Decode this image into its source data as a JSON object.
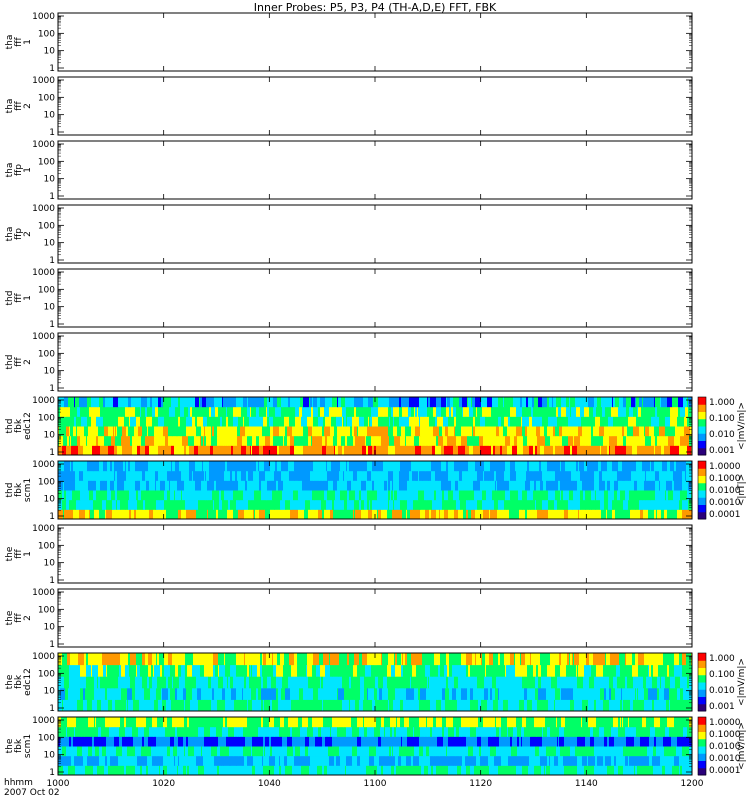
{
  "title": "Inner Probes: P5, P3, P4 (TH-A,D,E) FFT, FBK",
  "x_axis": {
    "ticks": [
      "1000",
      "1020",
      "1040",
      "1100",
      "1120",
      "1140",
      "1200"
    ],
    "label_line1": "hhmm",
    "label_line2": "2007 Oct 02"
  },
  "y_ticks": [
    "1000",
    "100",
    "10",
    "1"
  ],
  "panels": [
    {
      "id": "tha-fff-1",
      "label": [
        "tha",
        "fff",
        "1"
      ],
      "type": "empty"
    },
    {
      "id": "tha-fff-2",
      "label": [
        "tha",
        "fff",
        "2"
      ],
      "type": "empty"
    },
    {
      "id": "tha-ffp-1",
      "label": [
        "tha",
        "ffp",
        "1"
      ],
      "type": "empty"
    },
    {
      "id": "tha-ffp-2",
      "label": [
        "tha",
        "ffp",
        "2"
      ],
      "type": "empty"
    },
    {
      "id": "thd-fff-1",
      "label": [
        "thd",
        "fff",
        "1"
      ],
      "type": "empty"
    },
    {
      "id": "thd-fff-2",
      "label": [
        "thd",
        "fff",
        "2"
      ],
      "type": "empty"
    },
    {
      "id": "thd-fbk-edc12",
      "label": [
        "thd",
        "fbk",
        "edc12"
      ],
      "type": "spectrogram",
      "colorbar": {
        "ticks": [
          "1.000",
          "0.100",
          "0.010",
          "0.001"
        ],
        "unit": "<|mV/m|>"
      }
    },
    {
      "id": "thd-fbk-scm1",
      "label": [
        "thd",
        "fbk",
        "scm1"
      ],
      "type": "spectrogram",
      "colorbar": {
        "ticks": [
          "1.0000",
          "0.1000",
          "0.0100",
          "0.0010",
          "0.0001"
        ],
        "unit": "<|nT|>"
      }
    },
    {
      "id": "the-fff-1",
      "label": [
        "the",
        "fff",
        "1"
      ],
      "type": "empty"
    },
    {
      "id": "the-fff-2",
      "label": [
        "the",
        "fff",
        "2"
      ],
      "type": "empty"
    },
    {
      "id": "the-fbk-edc12",
      "label": [
        "the",
        "fbk",
        "edc12"
      ],
      "type": "spectrogram",
      "colorbar": {
        "ticks": [
          "1.000",
          "0.100",
          "0.010",
          "0.001"
        ],
        "unit": "<|mV/m|>"
      }
    },
    {
      "id": "the-fbk-scm1",
      "label": [
        "the",
        "fbk",
        "scm1"
      ],
      "type": "spectrogram",
      "colorbar": {
        "ticks": [
          "1.0000",
          "0.1000",
          "0.0100",
          "0.0010",
          "0.0001"
        ],
        "unit": "<|mV/m|>"
      }
    }
  ],
  "chart_data": {
    "type": "heatmap",
    "title": "Inner Probes: P5, P3, P4 (TH-A,D,E) FFT, FBK",
    "x_axis_label": "hhmm",
    "date": "2007 Oct 02",
    "x_ticks": [
      "1000",
      "1020",
      "1040",
      "1100",
      "1120",
      "1140",
      "1200"
    ],
    "x_range": [
      "1000",
      "1200"
    ],
    "y_scale": "log",
    "y_range": [
      1,
      1000
    ],
    "y_ticks": [
      1,
      10,
      100,
      1000
    ],
    "colorscale": [
      "#2a007a",
      "#0000ff",
      "#0099ff",
      "#00e5ff",
      "#00ff66",
      "#ffff00",
      "#ff9900",
      "#ff0000"
    ],
    "empty_panels": [
      "tha fff 1",
      "tha fff 2",
      "tha ffp 1",
      "tha ffp 2",
      "thd fff 1",
      "thd fff 2",
      "the fff 1",
      "the fff 2"
    ],
    "spectrograms": [
      {
        "name": "thd fbk edc12",
        "unit": "<|mV/m|>",
        "color_range": [
          0.001,
          1.0
        ],
        "bands": [
          {
            "band": 1,
            "level": [
              5,
              7
            ],
            "note": "bottom band, yellow-red dominant"
          },
          {
            "band": 2,
            "level": [
              4,
              6
            ],
            "note": "green-yellow"
          },
          {
            "band": 3,
            "level": [
              4,
              6
            ],
            "note": "green-yellow with red patches"
          },
          {
            "band": 4,
            "level": [
              3,
              5
            ],
            "note": "cyan-green"
          },
          {
            "band": 5,
            "level": [
              3,
              5
            ],
            "note": "green"
          },
          {
            "band": 6,
            "level": [
              1,
              4
            ],
            "note": "top band, blue-green-yellow mix"
          }
        ]
      },
      {
        "name": "thd fbk scm1",
        "unit": "<|nT|>",
        "color_range": [
          0.0001,
          1.0
        ],
        "bands": [
          {
            "band": 1,
            "level": [
              4,
              6
            ],
            "note": "bottom band, green-yellow"
          },
          {
            "band": 2,
            "level": [
              3,
              4
            ],
            "note": "cyan-green"
          },
          {
            "band": 3,
            "level": [
              3,
              4
            ],
            "note": "cyan"
          },
          {
            "band": 4,
            "level": [
              2,
              3
            ],
            "note": "blue-cyan"
          },
          {
            "band": 5,
            "level": [
              2,
              3
            ],
            "note": "blue-cyan"
          },
          {
            "band": 6,
            "level": [
              2,
              3
            ],
            "note": "top band, blue-cyan"
          }
        ]
      },
      {
        "name": "the fbk edc12",
        "unit": "<|mV/m|>",
        "color_range": [
          0.001,
          1.0
        ],
        "bands": [
          {
            "band": 1,
            "level": [
              3,
              4
            ],
            "note": "bottom band, cyan"
          },
          {
            "band": 2,
            "level": [
              2,
              4
            ],
            "note": "blue-cyan, yellow late"
          },
          {
            "band": 3,
            "level": [
              3,
              4
            ],
            "note": "cyan-green"
          },
          {
            "band": 4,
            "level": [
              3,
              5
            ],
            "note": "green-yellow"
          },
          {
            "band": 5,
            "level": [
              4,
              6
            ],
            "note": "top band, orange early then yellow"
          }
        ]
      },
      {
        "name": "the fbk scm1",
        "unit": "<|mV/m|>",
        "color_range": [
          0.0001,
          1.0
        ],
        "bands": [
          {
            "band": 1,
            "level": [
              3,
              4
            ],
            "note": "bottom band, cyan"
          },
          {
            "band": 2,
            "level": [
              2,
              3
            ],
            "note": "blue-cyan"
          },
          {
            "band": 3,
            "level": [
              3,
              4
            ],
            "note": "cyan"
          },
          {
            "band": 4,
            "level": [
              1,
              2
            ],
            "note": "blue"
          },
          {
            "band": 5,
            "level": [
              3,
              4
            ],
            "note": "cyan-green"
          },
          {
            "band": 6,
            "level": [
              4,
              5
            ],
            "note": "top band, green"
          }
        ]
      }
    ]
  }
}
